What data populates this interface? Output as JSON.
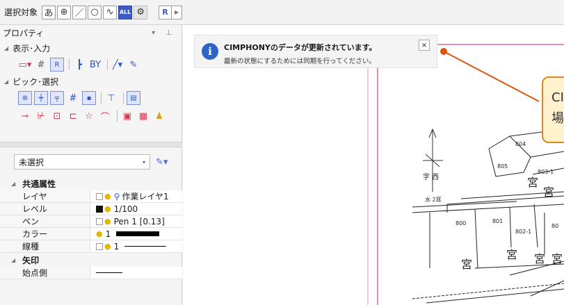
{
  "toolbar": {
    "label": "選択対象",
    "buttons": [
      {
        "glyph": "あ",
        "icon": "text-select-icon"
      },
      {
        "glyph": "⊕",
        "icon": "point-select-icon"
      },
      {
        "glyph": "／",
        "icon": "line-select-icon"
      },
      {
        "glyph": "○",
        "icon": "circle-select-icon"
      },
      {
        "glyph": "∿",
        "icon": "curve-select-icon"
      },
      {
        "glyph": "ALL",
        "icon": "select-all-icon"
      },
      {
        "glyph": "⚙",
        "icon": "gear-icon"
      }
    ],
    "r_button": "R",
    "r_arrow": "▶"
  },
  "panel": {
    "title": "プロパティ",
    "title_controls": "▾ ⊥",
    "groups": [
      {
        "label": "表示･入力",
        "icons": [
          "▭▾",
          "#",
          "R",
          "┣",
          "BY",
          "╱▾",
          "✎"
        ]
      },
      {
        "label": "ピック･選択",
        "row1": [
          "⊕",
          "┿",
          "╤",
          "#",
          "▪",
          "⊤",
          "▤"
        ],
        "row2": [
          "⊸",
          "⊬",
          "⊡",
          "⊏",
          "☆",
          "⌒",
          "▣",
          "▦",
          "♟"
        ]
      }
    ],
    "selection": "未選択",
    "dropdown_arrow": "▾",
    "filter_icon": "✎▾"
  },
  "properties": {
    "common_title": "共通属性",
    "common_rows": [
      {
        "name": "レイヤ",
        "value": "作業レイヤ1"
      },
      {
        "name": "レベル",
        "value": "1/100"
      },
      {
        "name": "ペン",
        "value": "Pen 1 [0.13]"
      },
      {
        "name": "カラー",
        "value": "1"
      },
      {
        "name": "線種",
        "value": "1"
      }
    ],
    "arrow_title": "矢印",
    "arrow_rows": [
      {
        "name": "始点側",
        "value": ""
      }
    ]
  },
  "notification": {
    "title": "CIMPHONYのデータが更新されています。",
    "message": "最新の状態にするためには同期を行ってください。",
    "close": "×"
  },
  "drawing": {
    "labels": [
      "804",
      "805",
      "803-1",
      "字 西",
      "水 2耳",
      "800",
      "801",
      "802-1",
      "80"
    ]
  },
  "callout": {
    "line1": "CI",
    "line2": "場"
  },
  "colors": {
    "accent": "#3e59c8",
    "info": "#2d66c7",
    "callout_border": "#e0891a",
    "callout_fill": "#fff2cc",
    "frame_line": "#c2188c"
  }
}
